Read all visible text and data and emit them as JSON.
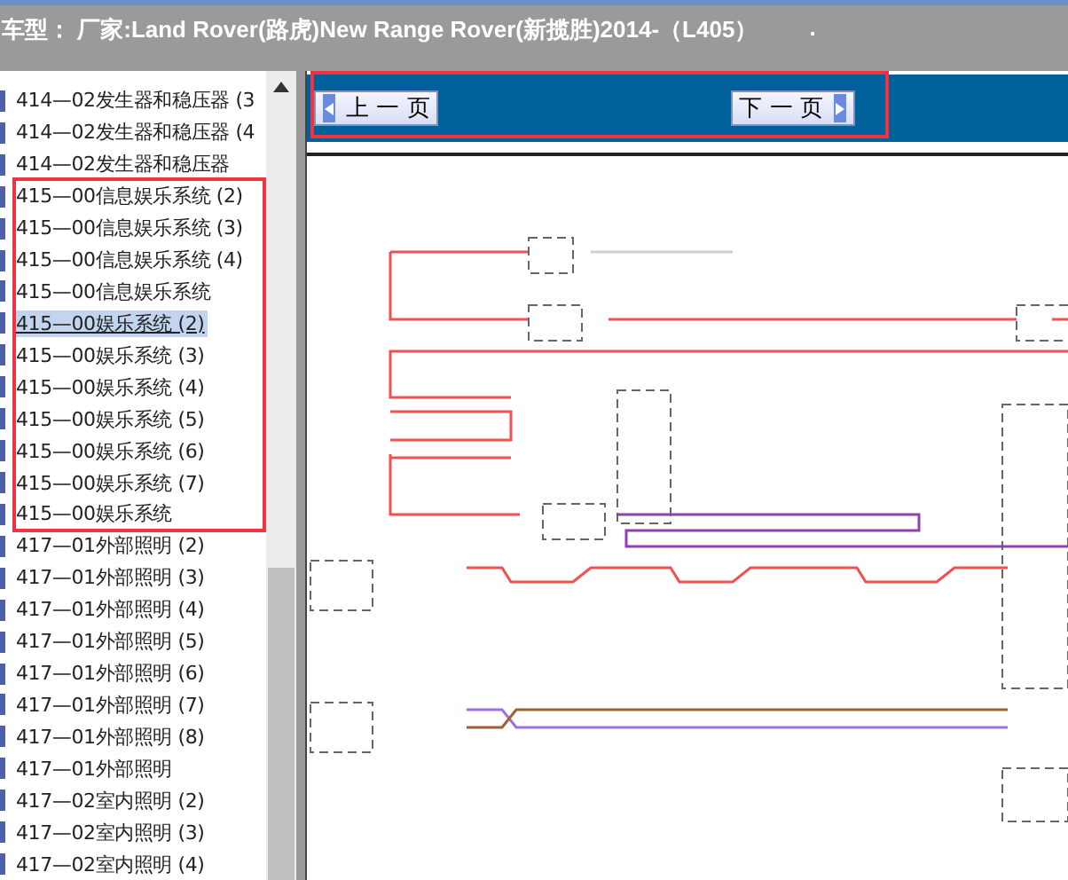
{
  "header": {
    "title": "车型： 厂家:Land Rover(路虎)New Range Rover(新揽胜)2014-（L405）",
    "mark": "."
  },
  "sidebar": {
    "items": [
      {
        "label": "414—02发生器和稳压器 (3",
        "selected": false
      },
      {
        "label": "414—02发生器和稳压器 (4",
        "selected": false
      },
      {
        "label": "414—02发生器和稳压器",
        "selected": false
      },
      {
        "label": "415—00信息娱乐系统 (2)",
        "selected": false
      },
      {
        "label": "415—00信息娱乐系统 (3)",
        "selected": false
      },
      {
        "label": "415—00信息娱乐系统 (4)",
        "selected": false
      },
      {
        "label": "415—00信息娱乐系统",
        "selected": false
      },
      {
        "label": "415—00娱乐系统 (2)",
        "selected": true
      },
      {
        "label": "415—00娱乐系统 (3)",
        "selected": false
      },
      {
        "label": "415—00娱乐系统 (4)",
        "selected": false
      },
      {
        "label": "415—00娱乐系统 (5)",
        "selected": false
      },
      {
        "label": "415—00娱乐系统 (6)",
        "selected": false
      },
      {
        "label": "415—00娱乐系统 (7)",
        "selected": false
      },
      {
        "label": "415—00娱乐系统",
        "selected": false
      },
      {
        "label": "417—01外部照明 (2)",
        "selected": false
      },
      {
        "label": "417—01外部照明 (3)",
        "selected": false
      },
      {
        "label": "417—01外部照明 (4)",
        "selected": false
      },
      {
        "label": "417—01外部照明 (5)",
        "selected": false
      },
      {
        "label": "417—01外部照明 (6)",
        "selected": false
      },
      {
        "label": "417—01外部照明 (7)",
        "selected": false
      },
      {
        "label": "417—01外部照明 (8)",
        "selected": false
      },
      {
        "label": "417—01外部照明",
        "selected": false
      },
      {
        "label": "417—02室内照明 (2)",
        "selected": false
      },
      {
        "label": "417—02室内照明 (3)",
        "selected": false
      },
      {
        "label": "417—02室内照明 (4)",
        "selected": false
      }
    ]
  },
  "toolbar": {
    "prev": "上 一 页",
    "next": "下 一 页"
  }
}
